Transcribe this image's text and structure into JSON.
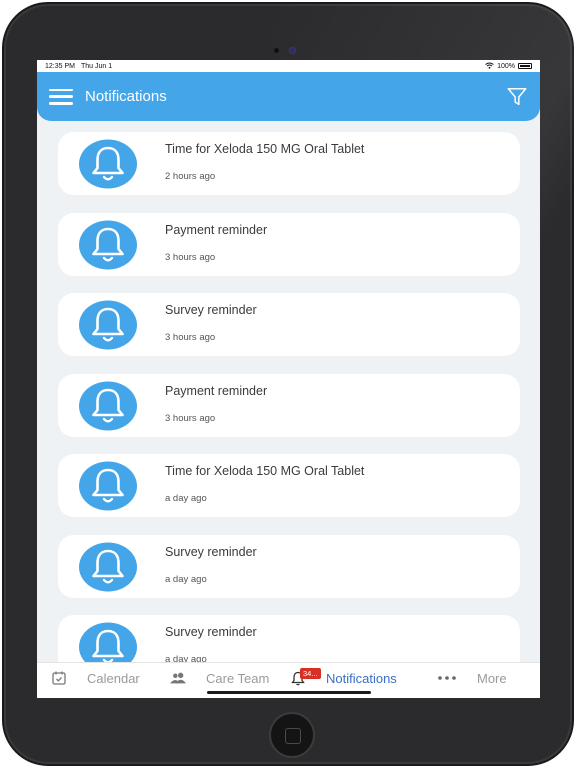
{
  "status_bar": {
    "time": "12:35 PM",
    "date": "Thu Jun 1",
    "battery": "100%",
    "wifi_icon": "wifi-icon",
    "battery_icon": "battery-icon"
  },
  "header": {
    "title": "Notifications",
    "menu_icon": "hamburger-menu-icon",
    "filter_icon": "filter-icon"
  },
  "colors": {
    "accent": "#44a6e9",
    "active_tab": "#3b6fc2",
    "badge": "#d93025",
    "background": "#eff2f5"
  },
  "notifications": [
    {
      "title": "Time for Xeloda 150 MG Oral Tablet",
      "time": "2 hours ago",
      "icon": "bell-icon"
    },
    {
      "title": "Payment reminder",
      "time": "3 hours ago",
      "icon": "bell-icon"
    },
    {
      "title": "Survey reminder",
      "time": "3 hours ago",
      "icon": "bell-icon"
    },
    {
      "title": "Payment reminder",
      "time": "3 hours ago",
      "icon": "bell-icon"
    },
    {
      "title": "Time for Xeloda 150 MG Oral Tablet",
      "time": "a day ago",
      "icon": "bell-icon"
    },
    {
      "title": "Survey reminder",
      "time": "a day ago",
      "icon": "bell-icon"
    },
    {
      "title": "Survey reminder",
      "time": "a day ago",
      "icon": "bell-icon"
    }
  ],
  "tabbar": {
    "tabs": [
      {
        "label": "Calendar",
        "icon": "calendar-icon",
        "active": false
      },
      {
        "label": "Care Team",
        "icon": "people-icon",
        "active": false
      },
      {
        "label": "Notifications",
        "icon": "bell-icon",
        "active": true,
        "badge": "34..."
      },
      {
        "label": "More",
        "icon": "more-dots-icon",
        "active": false
      }
    ]
  }
}
